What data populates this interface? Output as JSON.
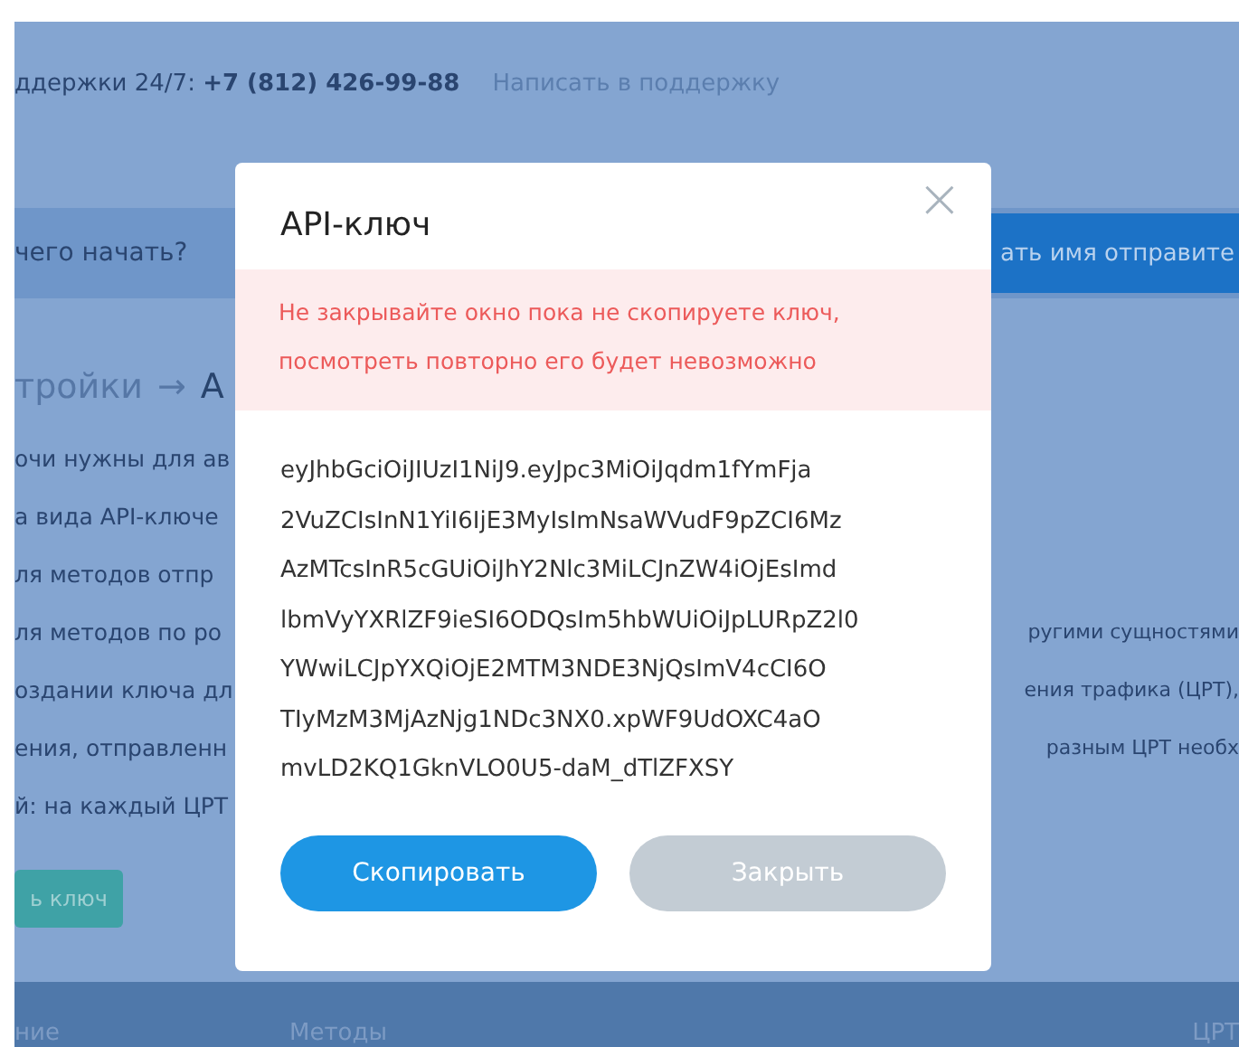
{
  "header": {
    "support_label": "ддержки 24/7:",
    "phone": "+7 (812) 426-99-88",
    "support_link": "Написать в поддержку"
  },
  "banner": {
    "text": "чего начать?",
    "button": "ать имя отправите"
  },
  "heading": {
    "crumb": "тройки",
    "arrow": "→",
    "current": "A"
  },
  "body": [
    {
      "left": "очи нужны для ав"
    },
    {
      "left": "а вида API-ключе"
    },
    {
      "left": "ля методов отпр"
    },
    {
      "left": "ля методов по ро",
      "right": "ругими сущностями"
    },
    {
      "left": "оздании ключа дл",
      "right": "ения трафика (ЦРТ),"
    },
    {
      "left": "ения, отправленн",
      "right": "разным ЦРТ необх"
    },
    {
      "left": "й: на каждый ЦРТ"
    }
  ],
  "create_button": "ь ключ",
  "table": {
    "columns": [
      "ние",
      "Методы",
      "ЦРТ"
    ]
  },
  "modal": {
    "title": "API-ключ",
    "close": "×",
    "warning": [
      "Не закрывайте окно пока не скопируете ключ,",
      "посмотреть повторно его будет невозможно"
    ],
    "key_lines": [
      "eyJhbGciOiJIUzI1NiJ9.eyJpc3MiOiJqdm1fYmFja",
      "2VuZCIsInN1YiI6IjE3MyIsImNsaWVudF9pZCI6Mz",
      "AzMTcsInR5cGUiOiJhY2Nlc3MiLCJnZW4iOjEsImd",
      "lbmVyYXRlZF9ieSI6ODQsIm5hbWUiOiJpLURpZ2l0",
      "YWwiLCJpYXQiOjE2MTM3NDE3NjQsImV4cCI6O",
      "TIyMzM3MjAzNjg1NDc3NX0.xpWF9UdOXC4aO",
      "mvLD2KQ1GknVLO0U5-daM_dTlZFXSY"
    ],
    "buttons": [
      {
        "label": "Скопировать",
        "kind": "primary"
      },
      {
        "label": "Закрыть",
        "kind": "secondary"
      }
    ]
  }
}
